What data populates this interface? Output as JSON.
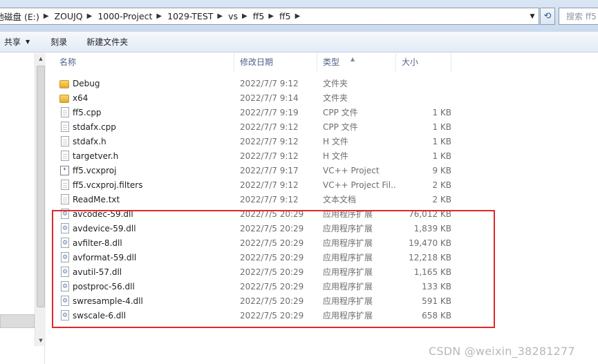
{
  "address": {
    "crumbs": [
      "本地磁盘 (E:)",
      "ZOUJQ",
      "1000-Project",
      "1029-TEST",
      "vs",
      "ff5",
      "ff5"
    ],
    "search_placeholder": "搜索 ff5"
  },
  "toolbar": {
    "share": "共享",
    "burn": "刻录",
    "new_folder": "新建文件夹"
  },
  "columns": {
    "name": "名称",
    "date": "修改日期",
    "type": "类型",
    "size": "大小"
  },
  "files": [
    {
      "icon": "folder-icon",
      "name": "Debug",
      "date": "2022/7/7 9:12",
      "type": "文件夹",
      "size": ""
    },
    {
      "icon": "folder-icon",
      "name": "x64",
      "date": "2022/7/7 9:14",
      "type": "文件夹",
      "size": ""
    },
    {
      "icon": "cpp-file-icon",
      "name": "ff5.cpp",
      "date": "2022/7/7 9:19",
      "type": "CPP 文件",
      "size": "1 KB"
    },
    {
      "icon": "cpp-file-icon",
      "name": "stdafx.cpp",
      "date": "2022/7/7 9:12",
      "type": "CPP 文件",
      "size": "1 KB"
    },
    {
      "icon": "header-file-icon",
      "name": "stdafx.h",
      "date": "2022/7/7 9:12",
      "type": "H 文件",
      "size": "1 KB"
    },
    {
      "icon": "header-file-icon",
      "name": "targetver.h",
      "date": "2022/7/7 9:12",
      "type": "H 文件",
      "size": "1 KB"
    },
    {
      "icon": "vcxproj-icon",
      "name": "ff5.vcxproj",
      "date": "2022/7/7 9:17",
      "type": "VC++ Project",
      "size": "9 KB"
    },
    {
      "icon": "filters-file-icon",
      "name": "ff5.vcxproj.filters",
      "date": "2022/7/7 9:12",
      "type": "VC++ Project Fil...",
      "size": "2 KB"
    },
    {
      "icon": "text-file-icon",
      "name": "ReadMe.txt",
      "date": "2022/7/7 9:12",
      "type": "文本文档",
      "size": "2 KB"
    },
    {
      "icon": "dll-icon",
      "name": "avcodec-59.dll",
      "date": "2022/7/5 20:29",
      "type": "应用程序扩展",
      "size": "76,012 KB"
    },
    {
      "icon": "dll-icon",
      "name": "avdevice-59.dll",
      "date": "2022/7/5 20:29",
      "type": "应用程序扩展",
      "size": "1,839 KB"
    },
    {
      "icon": "dll-icon",
      "name": "avfilter-8.dll",
      "date": "2022/7/5 20:29",
      "type": "应用程序扩展",
      "size": "19,470 KB"
    },
    {
      "icon": "dll-icon",
      "name": "avformat-59.dll",
      "date": "2022/7/5 20:29",
      "type": "应用程序扩展",
      "size": "12,218 KB"
    },
    {
      "icon": "dll-icon",
      "name": "avutil-57.dll",
      "date": "2022/7/5 20:29",
      "type": "应用程序扩展",
      "size": "1,165 KB"
    },
    {
      "icon": "dll-icon",
      "name": "postproc-56.dll",
      "date": "2022/7/5 20:29",
      "type": "应用程序扩展",
      "size": "133 KB"
    },
    {
      "icon": "dll-icon",
      "name": "swresample-4.dll",
      "date": "2022/7/5 20:29",
      "type": "应用程序扩展",
      "size": "591 KB"
    },
    {
      "icon": "dll-icon",
      "name": "swscale-6.dll",
      "date": "2022/7/5 20:29",
      "type": "应用程序扩展",
      "size": "658 KB"
    }
  ],
  "watermark": "CSDN @weixin_38281277",
  "colors": {
    "highlight": "#e0262b"
  }
}
